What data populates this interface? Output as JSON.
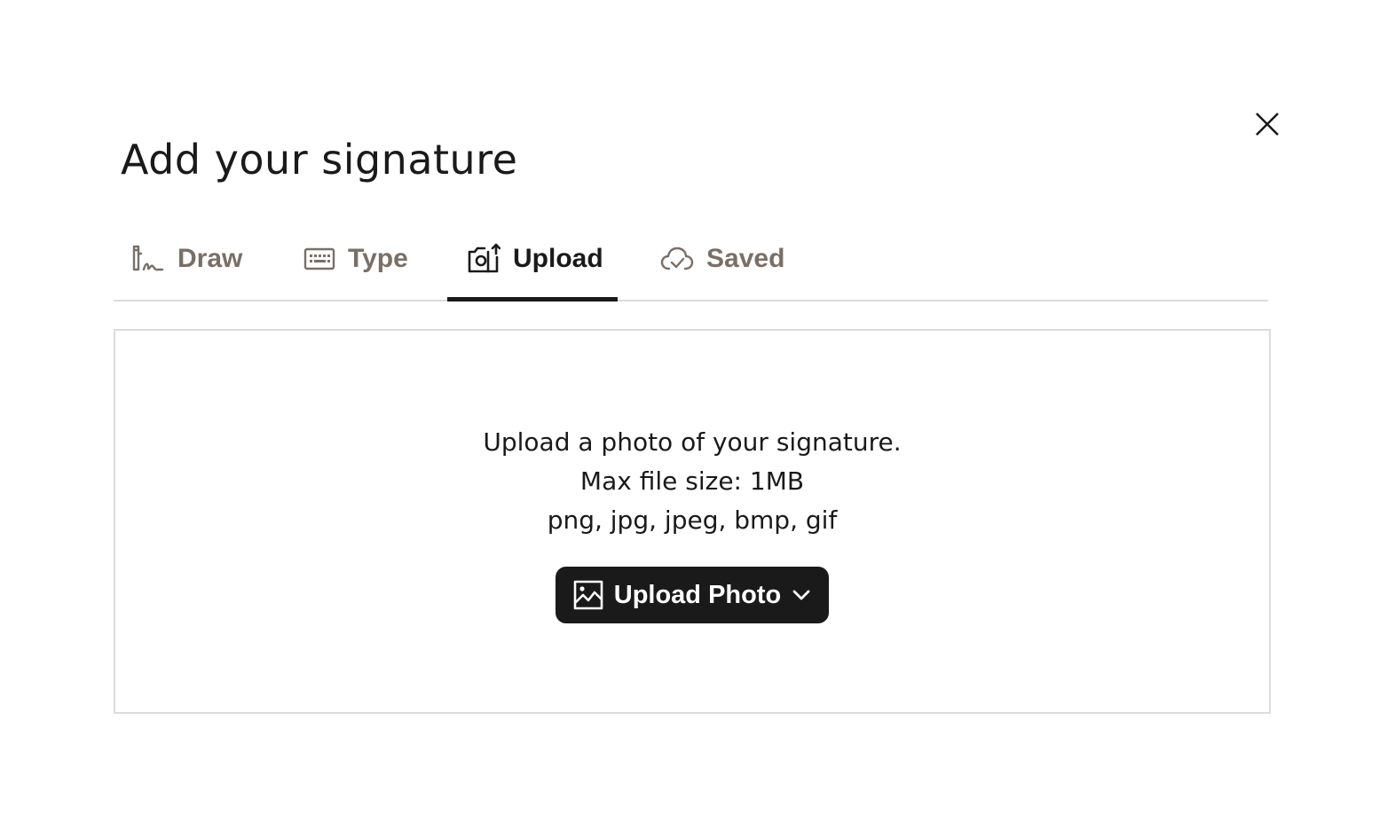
{
  "dialog": {
    "title": "Add your signature"
  },
  "tabs": [
    {
      "label": "Draw",
      "icon": "pen-signature-icon",
      "active": false
    },
    {
      "label": "Type",
      "icon": "keyboard-icon",
      "active": false
    },
    {
      "label": "Upload",
      "icon": "camera-upload-icon",
      "active": true
    },
    {
      "label": "Saved",
      "icon": "cloud-check-icon",
      "active": false
    }
  ],
  "upload": {
    "instructions": "Upload a photo of your signature.",
    "max_size": "Max file size: 1MB",
    "formats": "png, jpg, jpeg, bmp, gif",
    "button_label": "Upload Photo",
    "button_icon": "image-icon",
    "dropdown_icon": "chevron-down-icon"
  },
  "colors": {
    "accent": "#1a1a1a",
    "inactive_tab": "#7a6f66",
    "border": "#dcdcdc"
  }
}
